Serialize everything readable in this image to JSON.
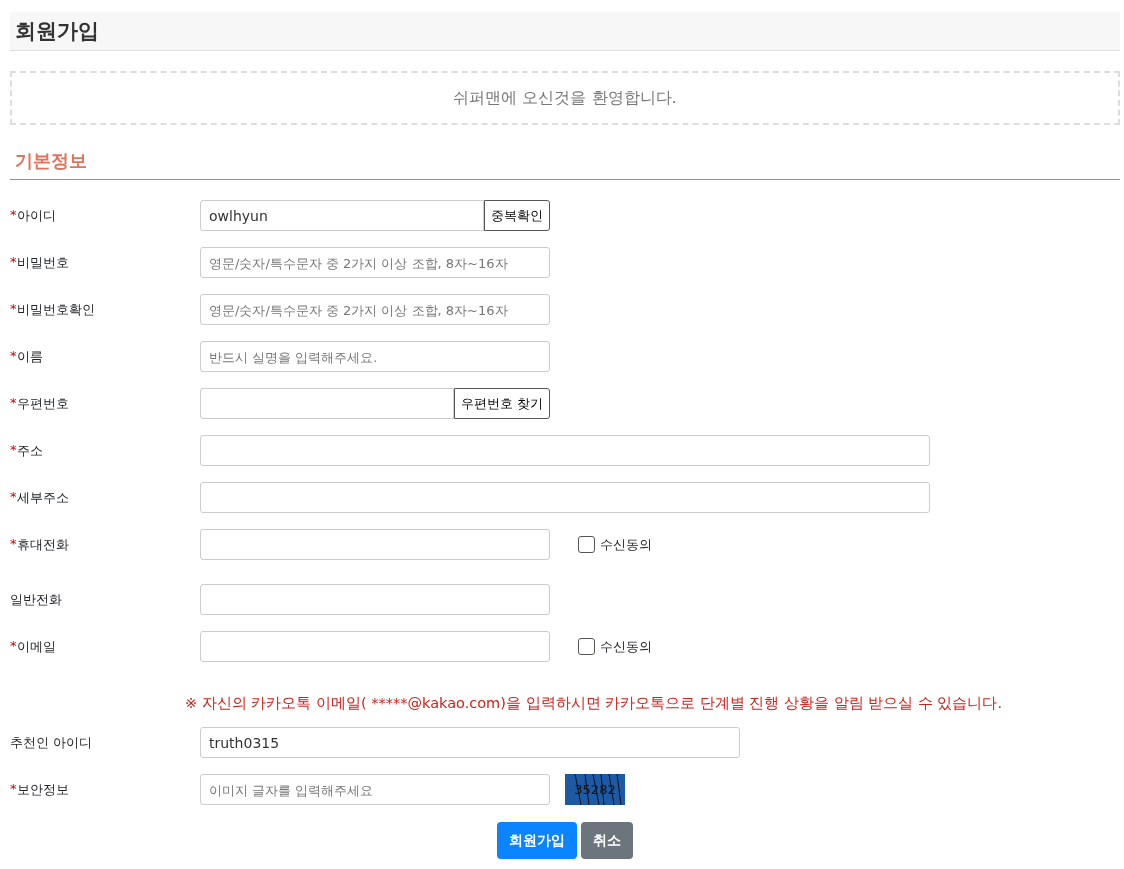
{
  "title": "회원가입",
  "welcome": "쉬퍼맨에 오신것을 환영합니다.",
  "section_title": "기본정보",
  "rows": [
    {
      "kind": "short",
      "required_mark": "*",
      "label": "아이디",
      "value": "owlhyun",
      "button": "중복확인"
    },
    {
      "kind": "short",
      "required_mark": "*",
      "label": "비밀번호",
      "placeholder": "영문/숫자/특수문자 중 2가지 이상 조합, 8자~16자"
    },
    {
      "kind": "short",
      "required_mark": "*",
      "label": "비밀번호확인",
      "placeholder": "영문/숫자/특수문자 중 2가지 이상 조합, 8자~16자"
    },
    {
      "kind": "short",
      "required_mark": "*",
      "label": "이름",
      "placeholder": "반드시 실명을 입력해주세요."
    },
    {
      "kind": "short",
      "required_mark": "*",
      "label": "우편번호",
      "button": "우편번호 찾기"
    },
    {
      "kind": "wide",
      "required_mark": "*",
      "label": "주소"
    },
    {
      "kind": "wide",
      "required_mark": "*",
      "label": "세부주소"
    },
    {
      "kind": "short",
      "required_mark": "*",
      "label": "휴대전화",
      "consent": {
        "label": "수신동의",
        "checked": false
      }
    },
    {
      "kind": "short",
      "label": "일반전화"
    },
    {
      "kind": "short",
      "required_mark": "*",
      "label": "이메일",
      "consent": {
        "label": "수신동의",
        "checked": false
      }
    },
    {
      "kind": "notice",
      "text": "※ 자신의 카카오톡 이메일( *****@kakao.com)을 입력하시면 카카오톡으로 단계별 진행 상황을 알림 받으실 수 있습니다."
    },
    {
      "kind": "medium",
      "label": "추천인 아이디",
      "value": "truth0315"
    },
    {
      "kind": "captcha",
      "required_mark": "*",
      "label": "보안정보",
      "placeholder": "이미지 글자를 입력해주세요",
      "code": "35282"
    }
  ],
  "buttons": [
    {
      "label": "회원가입",
      "kind": "primary"
    },
    {
      "label": "취소",
      "kind": "secondary"
    }
  ]
}
